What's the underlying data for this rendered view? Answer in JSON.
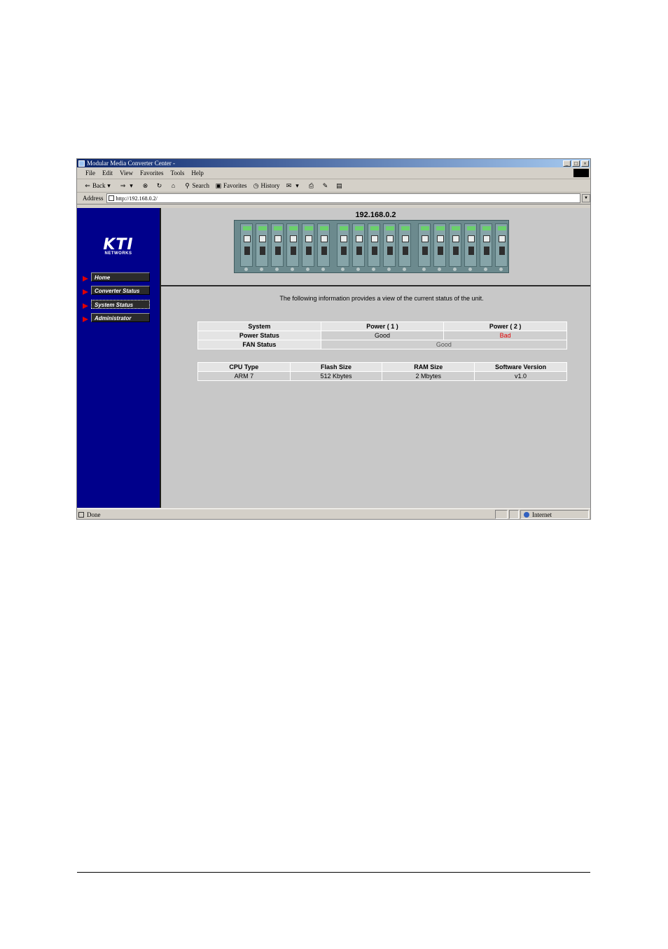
{
  "window": {
    "title": "Modular Media Converter Center -",
    "minimize": "_",
    "maximize": "□",
    "close": "×"
  },
  "menu": [
    "File",
    "Edit",
    "View",
    "Favorites",
    "Tools",
    "Help"
  ],
  "toolbar": {
    "back": "Back",
    "search": "Search",
    "favorites": "Favorites",
    "history": "History"
  },
  "address": {
    "label": "Address",
    "url": "http://192.168.0.2/"
  },
  "sidebar": {
    "logo": "KTI",
    "logo_sub": "NETWORKS",
    "items": [
      {
        "label": "Home"
      },
      {
        "label": "Converter Status"
      },
      {
        "label": "System Status"
      },
      {
        "label": "Administrator"
      }
    ]
  },
  "header": {
    "ip": "192.168.0.2"
  },
  "main": {
    "intro": "The following information provides a view of the current status of the unit.",
    "power_table": {
      "headers": [
        "System",
        "Power ( 1 )",
        "Power ( 2 )"
      ],
      "power_status_label": "Power Status",
      "power1": "Good",
      "power2": "Bad",
      "fan_label": "FAN Status",
      "fan_value": "Good"
    },
    "info_table": {
      "headers": [
        "CPU Type",
        "Flash Size",
        "RAM Size",
        "Software Version"
      ],
      "values": [
        "ARM 7",
        "512 Kbytes",
        "2 Mbytes",
        "v1.0"
      ]
    }
  },
  "status": {
    "left": "Done",
    "zone": "Internet"
  },
  "colors": {
    "sidebar_bg": "#00008b",
    "arrow": "#e00000",
    "bad_text": "#e00000",
    "frame_bg": "#c8c8c8"
  }
}
